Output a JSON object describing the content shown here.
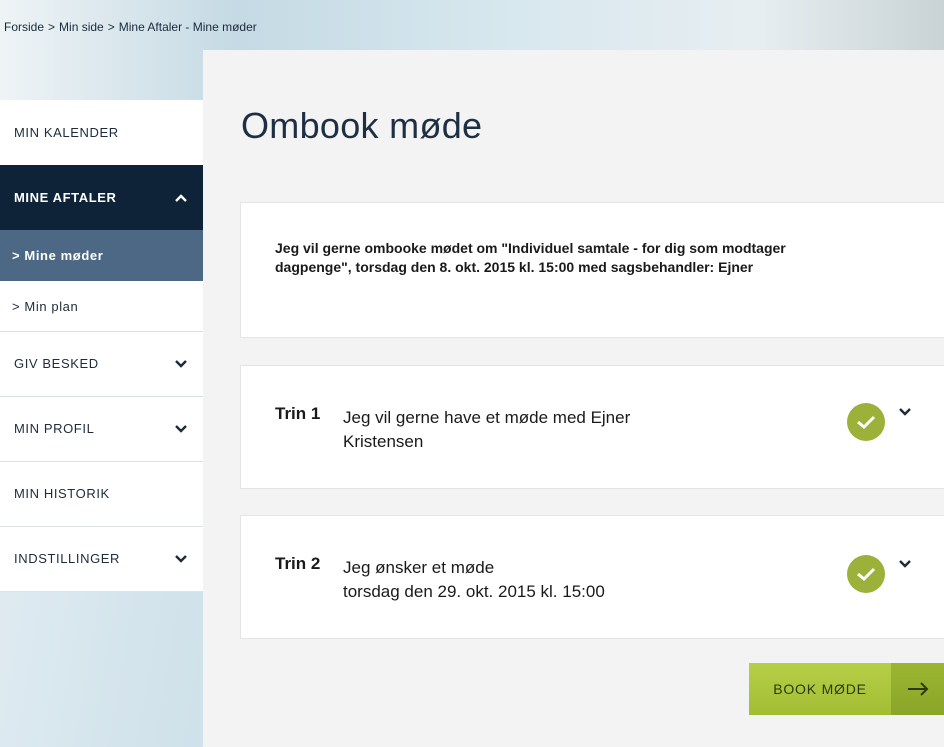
{
  "breadcrumb": {
    "items": [
      "Forside",
      "Min side",
      "Mine Aftaler - Mine møder"
    ],
    "separator": ">"
  },
  "sidebar": {
    "items": [
      {
        "label": "MIN KALENDER"
      },
      {
        "label": "MINE AFTALER",
        "expanded": true
      },
      {
        "label": "> Mine møder",
        "active": true
      },
      {
        "label": "> Min plan"
      },
      {
        "label": "GIV BESKED"
      },
      {
        "label": "MIN PROFIL"
      },
      {
        "label": "MIN HISTORIK"
      },
      {
        "label": "INDSTILLINGER"
      }
    ]
  },
  "main": {
    "title": "Ombook møde",
    "info_text": "Jeg vil gerne ombooke mødet om \"Individuel samtale - for dig som modtager dagpenge\", torsdag den 8. okt. 2015 kl. 15:00 med sagsbehandler: Ejner",
    "steps": [
      {
        "label": "Trin 1",
        "line1": "Jeg vil gerne have et møde med Ejner",
        "line2": "Kristensen",
        "status_icon": "check-icon"
      },
      {
        "label": "Trin 2",
        "line1": "Jeg ønsker et møde",
        "line2": "torsdag den 29. okt. 2015 kl. 15:00",
        "status_icon": "check-icon"
      }
    ],
    "book_button": {
      "label": "BOOK MØDE",
      "icon": "arrow-right-icon"
    }
  },
  "colors": {
    "nav_active_dark": "#0f2338",
    "nav_sub_active": "#4c6884",
    "check_green": "#9bb13a",
    "button_green": "#a7c13c",
    "title_navy": "#1e2f44"
  }
}
